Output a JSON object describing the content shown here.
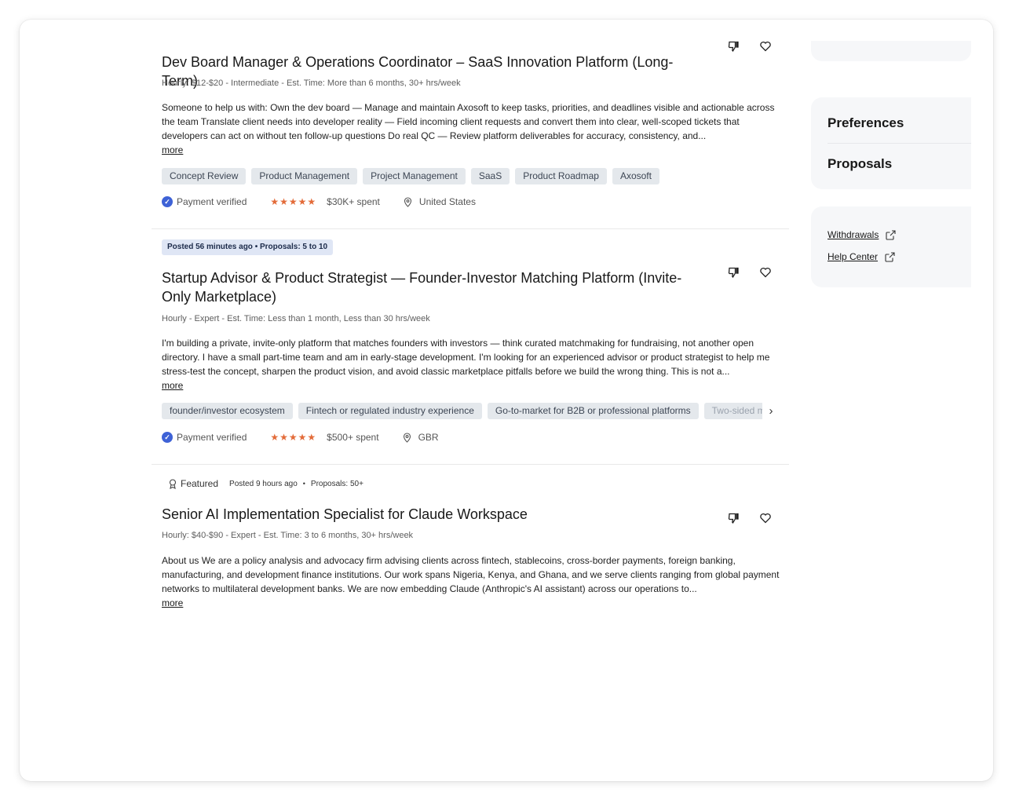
{
  "jobs": [
    {
      "title": "Dev Board Manager & Operations Coordinator – SaaS Innovation Platform (Long-Term)",
      "meta": "Hourly: $12-$20 - Intermediate - Est. Time: More than 6 months, 30+ hrs/week",
      "description": "Someone to help us with: Own the dev board — Manage and maintain Axosoft to keep tasks, priorities, and deadlines visible and actionable across the team Translate client needs into developer reality — Field incoming client requests and convert them into clear, well-scoped tickets that developers can act on without ten follow-up questions Do real QC — Review platform deliverables for accuracy, consistency, and...",
      "more": "more",
      "skills": [
        "Concept Review",
        "Product Management",
        "Project Management",
        "SaaS",
        "Product Roadmap",
        "Axosoft"
      ],
      "payment": "Payment verified",
      "rating": "★★★★★",
      "spent": "$30K+ spent",
      "location": "United States"
    },
    {
      "badge": "Posted 56 minutes ago  •  Proposals: 5 to 10",
      "title": "Startup Advisor & Product Strategist — Founder-Investor Matching Platform (Invite-Only Marketplace)",
      "meta": "Hourly - Expert - Est. Time: Less than 1 month, Less than 30 hrs/week",
      "description": "I'm building a private, invite-only platform that matches founders with investors — think curated matchmaking for fundraising, not another open directory. I have a small part-time team and am in early-stage development. I'm looking for an experienced advisor or product strategist to help me stress-test the concept, sharpen the product vision, and avoid classic marketplace pitfalls before we build the wrong thing. This is not a...",
      "more": "more",
      "skills": [
        "founder/investor ecosystem",
        "Fintech or regulated industry experience",
        "Go-to-market for B2B or professional platforms",
        "Two-sided marketplace"
      ],
      "payment": "Payment verified",
      "rating": "★★★★★",
      "spent": "$500+ spent",
      "location": "GBR"
    },
    {
      "featured": "Featured",
      "posted": "Posted 9 hours ago",
      "proposals": "Proposals: 50+",
      "title": "Senior AI Implementation Specialist for Claude Workspace",
      "meta": "Hourly: $40-$90 - Expert - Est. Time: 3 to 6 months, 30+ hrs/week",
      "description": "About us We are a policy analysis and advocacy firm advising clients across fintech, stablecoins, cross-border payments, foreign banking, manufacturing, and development finance institutions. Our work spans Nigeria, Kenya, and Ghana, and we serve clients ranging from global payment networks to multilateral development banks. We are now embedding Claude (Anthropic's AI assistant) across our operations to...",
      "more": "more"
    }
  ],
  "sidebar": {
    "nav": [
      "Preferences",
      "Proposals"
    ],
    "links": [
      "Withdrawals",
      "Help Center"
    ]
  },
  "colors": {
    "accent_verified": "#3e62d6",
    "star": "#e36b39",
    "skill_bg": "#e4e8ec",
    "badge_bg": "#dfe6f5",
    "sidebar_bg": "#f6f7f9"
  },
  "icons": {
    "dislike": "thumbs-down-icon",
    "save": "heart-icon",
    "verified": "check-badge-icon",
    "location": "location-pin-icon",
    "featured": "award-icon",
    "external": "external-link-icon",
    "scroll": "chevron-right-icon"
  }
}
